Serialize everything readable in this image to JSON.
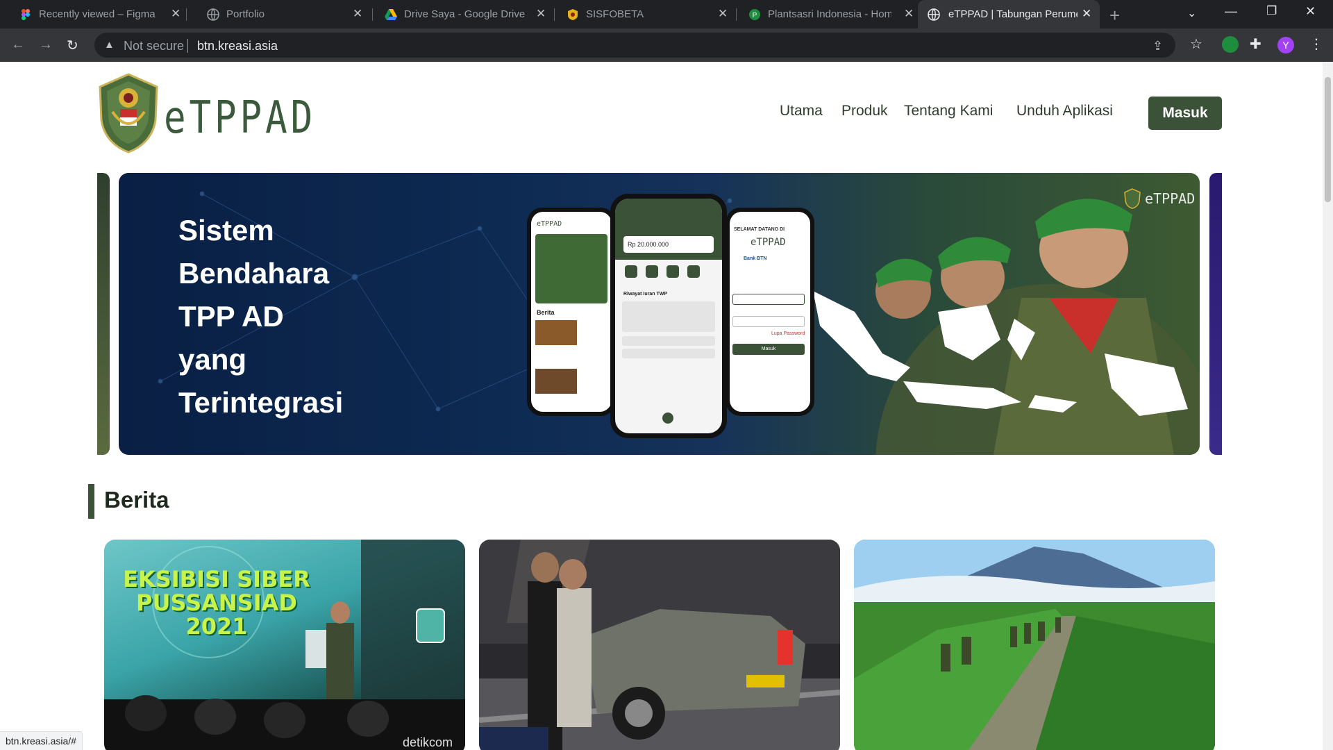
{
  "browser": {
    "tabs": [
      {
        "title": "Recently viewed – Figma",
        "icon": "figma-icon"
      },
      {
        "title": "Portfolio",
        "icon": "globe-icon"
      },
      {
        "title": "Drive Saya - Google Drive",
        "icon": "google-drive-icon"
      },
      {
        "title": "SISFOBETA",
        "icon": "emblem-icon"
      },
      {
        "title": "Plantsasri Indonesia - Hom",
        "icon": "plantsasri-icon"
      },
      {
        "title": "eTPPAD | Tabungan Perume",
        "icon": "globe-icon",
        "active": true
      }
    ],
    "address": {
      "security_label": "Not secure",
      "url": "btn.kreasi.asia"
    },
    "profile_initial": "Y",
    "status_url": "btn.kreasi.asia/#"
  },
  "site": {
    "logo_text": "eTPPAD",
    "nav": [
      "Utama",
      "Produk",
      "Tentang Kami",
      "Unduh Aplikasi"
    ],
    "login_button": "Masuk",
    "banner": {
      "lines": [
        "Sistem",
        "Bendahara",
        "TPP AD",
        "yang",
        "Terintegrasi"
      ],
      "brand_mark": "eTPPAD",
      "phone_labels": {
        "left_app_name": "eTPPAD",
        "left_section": "Berita",
        "center_balance": "Rp 20.000.000",
        "center_history": "Riwayat Iuran TWP",
        "right_welcome": "SELAMAT DATANG DI",
        "right_app_name": "eTPPAD",
        "right_bank": "Bank BTN",
        "right_forgot": "Lupa Password",
        "right_login": "Masuk"
      }
    },
    "news_section_title": "Berita",
    "news_cards": [
      {
        "image_caption": "EKSIBISI SIBER PUSSANSIAD 2021",
        "watermark": "detikcom"
      },
      {
        "image_caption": ""
      },
      {
        "image_caption": ""
      }
    ]
  },
  "colors": {
    "brand_green": "#3b5239",
    "chrome_dark": "#202124",
    "chrome_mid": "#35363a"
  }
}
